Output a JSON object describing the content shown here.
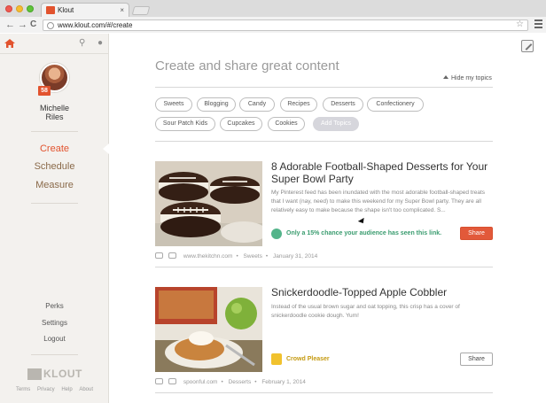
{
  "browser": {
    "tab_title": "Klout",
    "tab_close": "×",
    "url": "www.klout.com/#/create",
    "back": "←",
    "forward": "→",
    "reload": "C"
  },
  "sidebar": {
    "user": {
      "first_name": "Michelle",
      "last_name": "Riles",
      "score": "58"
    },
    "nav": [
      {
        "label": "Create",
        "active": true
      },
      {
        "label": "Schedule",
        "active": false
      },
      {
        "label": "Measure",
        "active": false
      }
    ],
    "secondary": [
      "Perks",
      "Settings",
      "Logout"
    ],
    "logo_text": "KLOUT",
    "footer": [
      "Terms",
      "Privacy",
      "Help",
      "About"
    ]
  },
  "main": {
    "title": "Create and share great content",
    "hide_topics": "Hide my topics",
    "topics_row1": [
      "Sweets",
      "Blogging",
      "Candy",
      "Recipes",
      "Desserts",
      "Confectionery"
    ],
    "topics_row2": [
      "Sour Patch Kids",
      "Cupcakes",
      "Cookies"
    ],
    "add_topics": "Add Topics",
    "cards": [
      {
        "title": "8 Adorable Football-Shaped Desserts for Your Super Bowl Party",
        "description": "My Pinterest feed has been inundated with the most adorable football-shaped treats that I want (nay, need) to make this weekend for my Super Bowl party. They are all relatively easy to make because the shape isn't too complicated. S...",
        "badge": "Only a 15% chance your audience has seen this link.",
        "share_label": "Share",
        "source": "www.thekitchn.com",
        "topic": "Sweets",
        "date": "January 31, 2014"
      },
      {
        "title": "Snickerdoodle-Topped Apple Cobbler",
        "description": "Instead of the usual brown sugar and oat topping, this crisp has a cover of snickerdoodle cookie dough. Yum!",
        "badge": "Crowd Pleaser",
        "share_label": "Share",
        "source": "spoonful.com",
        "topic": "Desserts",
        "date": "February 1, 2014"
      }
    ]
  },
  "colors": {
    "accent": "#e2532e",
    "reach": "#3a9c6f",
    "crowd": "#f1c22e"
  }
}
